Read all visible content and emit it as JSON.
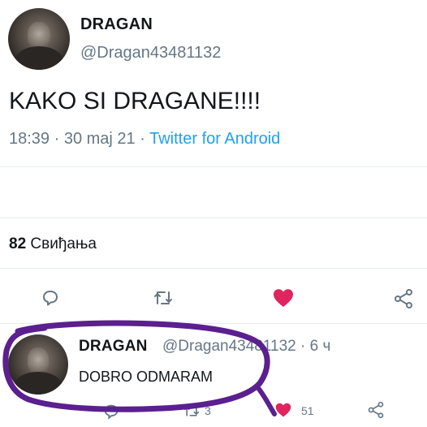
{
  "tweet": {
    "author_name": "DRAGAN",
    "author_handle": "@Dragan43481132",
    "text": "KAKO SI DRAGANE!!!!",
    "time": "18:39",
    "date": "30 maj 21",
    "client": "Twitter for Android",
    "likes_count": "82",
    "likes_label": "Свиђања"
  },
  "reply": {
    "author_name": "DRAGAN",
    "author_handle": "@Dragan43481132",
    "age": "6 ч",
    "text": "DOBRO ODMARAM",
    "retweets": "3",
    "likes": "51"
  },
  "colors": {
    "accent": "#1da1f2",
    "like": "#e0245e",
    "muted": "#657786",
    "scribble": "#5b1f8f"
  },
  "icons": [
    "avatar",
    "reply-icon",
    "retweet-icon",
    "heart-icon",
    "share-icon"
  ]
}
